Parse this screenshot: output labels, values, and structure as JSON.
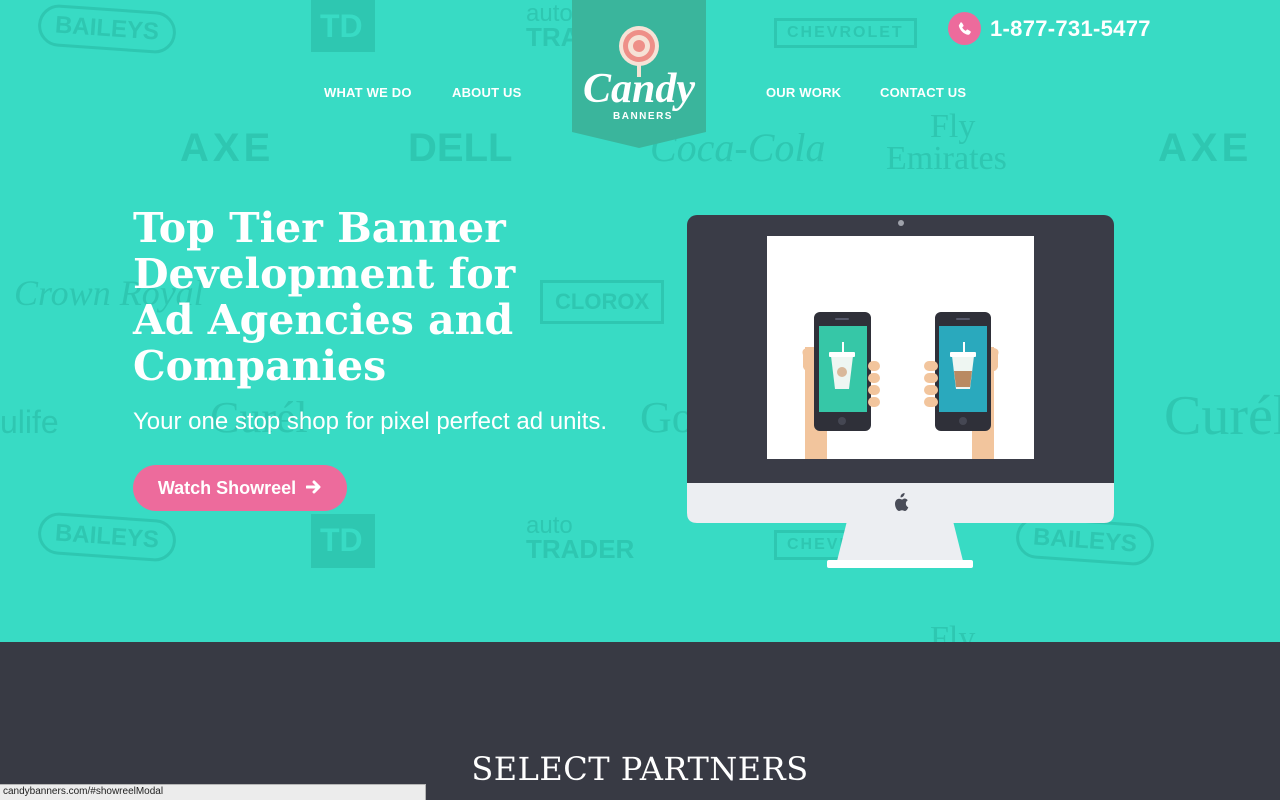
{
  "header": {
    "phone_number": "1-877-731-5477",
    "nav": {
      "what_we_do": "WHAT WE DO",
      "about_us": "ABOUT US",
      "our_work": "OUR WORK",
      "contact_us": "CONTACT US"
    },
    "logo": {
      "word": "Candy",
      "sub": "BANNERS"
    }
  },
  "hero": {
    "headline": "Top Tier Banner Development for Ad Agencies and Companies",
    "tagline": "Your one stop shop for pixel perfect ad units.",
    "cta_label": "Watch Showreel"
  },
  "background_logos": [
    "BAILEYS",
    "TD",
    "auto",
    "TRADER",
    "CHEVROLET",
    "AXE",
    "DELL",
    "Coca-Cola",
    "Fly",
    "Emirates",
    "AXE",
    "Crown Royal",
    "CLOROX",
    "Curél",
    "ulife",
    "Go",
    "Curél",
    "BAILEYS",
    "TD",
    "auto",
    "TRADER",
    "CHEVROLET",
    "BAILEYS",
    "Fly"
  ],
  "partners": {
    "title": "SELECT PARTNERS"
  },
  "status_bar": {
    "url": "candybanners.com/#showreelModal"
  },
  "colors": {
    "hero_bg": "#38dbc4",
    "accent_pink": "#ed6b9c",
    "dark_bg": "#383a44",
    "logo_banner": "#3ab59c"
  },
  "icons": [
    "phone-icon",
    "arrow-right-icon",
    "lollipop-icon",
    "apple-icon"
  ]
}
